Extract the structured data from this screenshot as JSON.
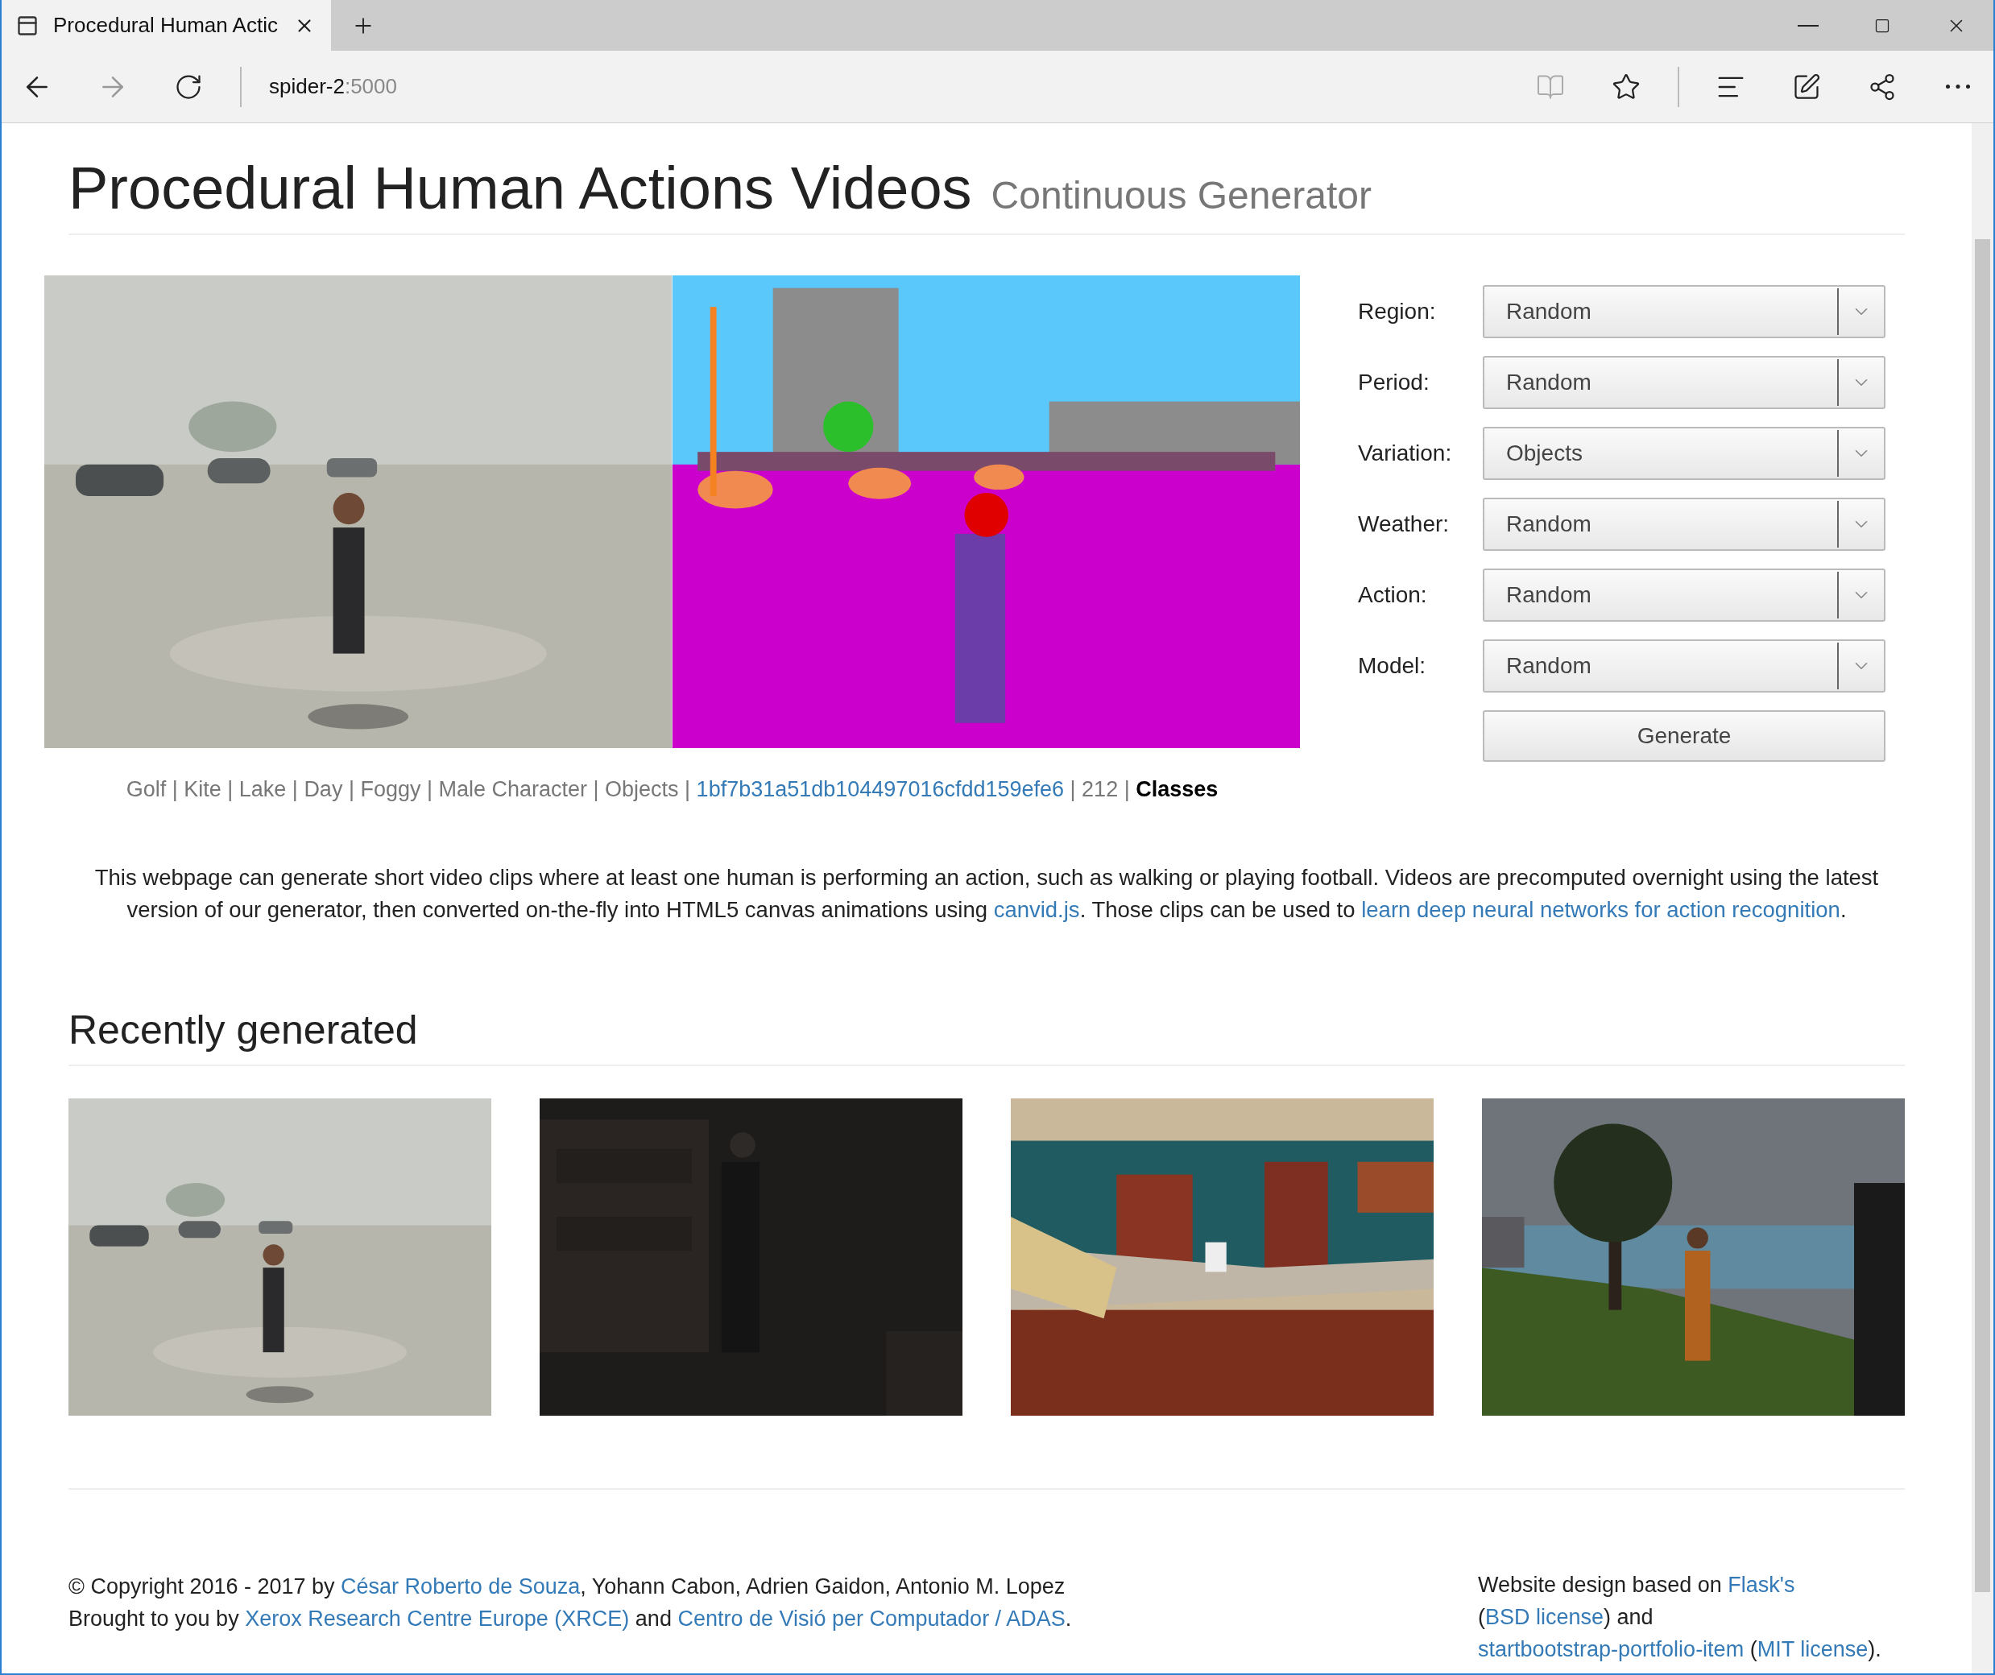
{
  "browser": {
    "tab_title": "Procedural Human Actic",
    "address": {
      "host": "spider-2",
      "port": ":5000"
    }
  },
  "header": {
    "title": "Procedural Human Actions Videos",
    "subtitle": "Continuous Generator"
  },
  "form": {
    "fields": [
      {
        "label": "Region:",
        "value": "Random"
      },
      {
        "label": "Period:",
        "value": "Random"
      },
      {
        "label": "Variation:",
        "value": "Objects"
      },
      {
        "label": "Weather:",
        "value": "Random"
      },
      {
        "label": "Action:",
        "value": "Random"
      },
      {
        "label": "Model:",
        "value": "Random"
      }
    ],
    "button": "Generate"
  },
  "caption": [
    {
      "kind": "text",
      "text": "Golf | Kite | Lake | Day | Foggy | Male Character | Objects | "
    },
    {
      "kind": "link",
      "text": "1bf7b31a51db104497016cfdd159efe6"
    },
    {
      "kind": "text",
      "text": " | 212 | "
    },
    {
      "kind": "bold",
      "text": "Classes"
    }
  ],
  "description": [
    {
      "kind": "text",
      "text": "This webpage can generate short video clips where at least one human is performing an action, such as walking or playing football. Videos are precomputed overnight using the latest version of our generator, then converted on-the-fly into HTML5 canvas animations using "
    },
    {
      "kind": "link",
      "text": "canvid.js"
    },
    {
      "kind": "text",
      "text": ". Those clips can be used to "
    },
    {
      "kind": "link",
      "text": "learn deep neural networks for action recognition"
    },
    {
      "kind": "text",
      "text": "."
    }
  ],
  "recent": {
    "title": "Recently generated"
  },
  "footer": {
    "left": [
      [
        {
          "kind": "text",
          "text": "© Copyright 2016 - 2017 by "
        },
        {
          "kind": "link",
          "text": "César Roberto de Souza"
        },
        {
          "kind": "text",
          "text": ", Yohann Cabon, Adrien Gaidon, Antonio M. Lopez"
        }
      ],
      [
        {
          "kind": "text",
          "text": "Brought to you by "
        },
        {
          "kind": "link",
          "text": "Xerox Research Centre Europe (XRCE)"
        },
        {
          "kind": "text",
          "text": " and "
        },
        {
          "kind": "link",
          "text": "Centro de Visió per Computador / ADAS"
        },
        {
          "kind": "text",
          "text": "."
        }
      ]
    ],
    "right": [
      {
        "kind": "text",
        "text": "Website design based on "
      },
      {
        "kind": "link",
        "text": "Flask's"
      },
      {
        "kind": "text",
        "text": " ("
      },
      {
        "kind": "link",
        "text": "BSD license"
      },
      {
        "kind": "text",
        "text": ") and "
      },
      {
        "kind": "link",
        "text": "startbootstrap-portfolio-item"
      },
      {
        "kind": "text",
        "text": " ("
      },
      {
        "kind": "link",
        "text": "MIT license"
      },
      {
        "kind": "text",
        "text": ")."
      }
    ]
  }
}
